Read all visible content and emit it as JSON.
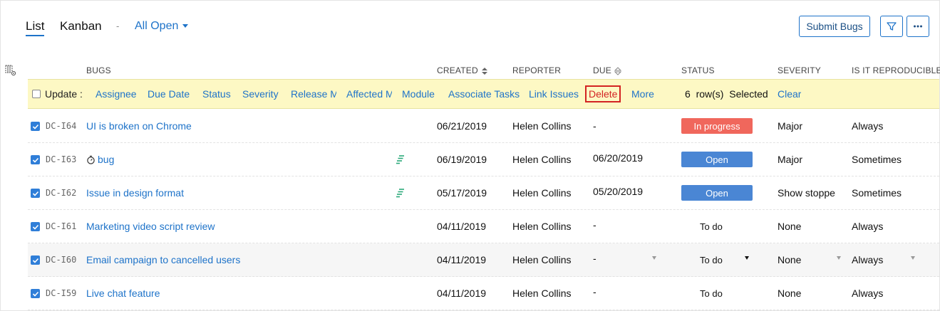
{
  "toolbar": {
    "tab_list": "List",
    "tab_kanban": "Kanban",
    "separator": "-",
    "filter_view": "All Open",
    "submit_label": "Submit Bugs"
  },
  "columns": {
    "bugs": "BUGS",
    "created": "CREATED",
    "reporter": "REPORTER",
    "due": "DUE",
    "status": "STATUS",
    "severity": "SEVERITY",
    "reproducible": "IS IT REPRODUCIBLE"
  },
  "update_bar": {
    "label": "Update :",
    "actions": [
      "Assignee",
      "Due Date",
      "Status",
      "Severity",
      "Release M",
      "Affected M",
      "Module",
      "Associate Tasks",
      "Link Issues"
    ],
    "delete_label": "Delete",
    "more_label": "More",
    "selected_text": "6  row(s)  Selected",
    "clear_label": "Clear"
  },
  "colors": {
    "accent": "#1e73c9",
    "in_progress": "#f0675c",
    "open": "#4a86d4",
    "highlight": "#fdf8c4",
    "delete_border": "#d32323"
  },
  "rows": [
    {
      "id": "DC-I64",
      "title": "UI is broken on Chrome",
      "created": "06/21/2019",
      "reporter": "Helen Collins",
      "due": "-",
      "status": "In progress",
      "severity": "Major",
      "reproducible": "Always"
    },
    {
      "id": "DC-I63",
      "title": "bug",
      "created": "06/19/2019",
      "reporter": "Helen Collins",
      "due": "06/20/2019",
      "status": "Open",
      "severity": "Major",
      "reproducible": "Sometimes"
    },
    {
      "id": "DC-I62",
      "title": "Issue in design format",
      "created": "05/17/2019",
      "reporter": "Helen Collins",
      "due": "05/20/2019",
      "status": "Open",
      "severity": "Show stopper",
      "reproducible": "Sometimes"
    },
    {
      "id": "DC-I61",
      "title": "Marketing video script review",
      "created": "04/11/2019",
      "reporter": "Helen Collins",
      "due": "-",
      "status": "To do",
      "severity": "None",
      "reproducible": "Always"
    },
    {
      "id": "DC-I60",
      "title": "Email campaign to cancelled users",
      "created": "04/11/2019",
      "reporter": "Helen Collins",
      "due": "-",
      "status": "To do",
      "severity": "None",
      "reproducible": "Always"
    },
    {
      "id": "DC-I59",
      "title": "Live chat feature",
      "created": "04/11/2019",
      "reporter": "Helen Collins",
      "due": "-",
      "status": "To do",
      "severity": "None",
      "reproducible": "Always"
    }
  ]
}
